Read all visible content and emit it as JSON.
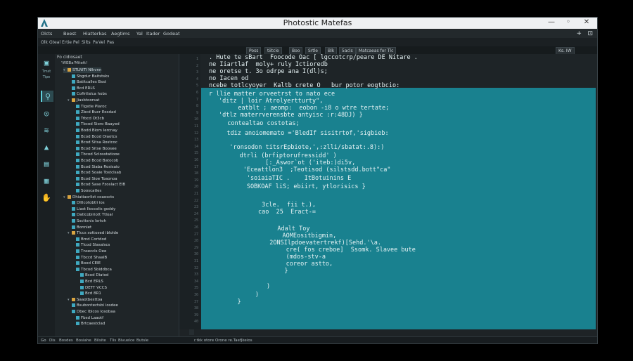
{
  "window": {
    "title": "Photostic Matefas",
    "controls": [
      "—",
      "◦",
      "✕"
    ]
  },
  "menubar": {
    "items": [
      "Olcts",
      "Beest",
      "Hiatterkas",
      "Aegtims",
      "Yal",
      "Itader",
      "Godeat"
    ],
    "right": [
      "+",
      "⊡"
    ]
  },
  "toolbar": {
    "items": [
      "Olk",
      "Gteal",
      "Ertie",
      "Pel",
      "Silts",
      "Pa",
      "Vel",
      "Pas"
    ]
  },
  "tabbar": {
    "tabs": [
      "Poss",
      "tiitcle",
      "Boo",
      "Srtle",
      "Blk",
      "5acls",
      "Matcaeas for Tlc",
      "Ks. IW"
    ]
  },
  "activity": {
    "label1": "Tmst",
    "label2": "Tipe"
  },
  "sidebar": {
    "header": "Fo cidiosaet",
    "subheader": "'WEBa'Mitett!",
    "tree": [
      {
        "label": "STLNITI Nlkvnn",
        "indent": 2,
        "kind": "folder",
        "tw": "▾"
      },
      {
        "label": "Sbgdur Baitstsks",
        "indent": 3,
        "kind": "file",
        "tw": ""
      },
      {
        "label": "Batitcalles Bsst",
        "indent": 3,
        "kind": "file",
        "tw": ""
      },
      {
        "label": "Bcd ERLS",
        "indent": 3,
        "kind": "file",
        "tw": ""
      },
      {
        "label": "Cofirtlalca hobs",
        "indent": 3,
        "kind": "file",
        "tw": ""
      },
      {
        "label": "Jiasbtoorsat",
        "indent": 3,
        "kind": "folder",
        "tw": "▾"
      },
      {
        "label": "Tigstle Plaroc",
        "indent": 4,
        "kind": "file",
        "tw": ""
      },
      {
        "label": "Zbcd Bucr Eosdad",
        "indent": 4,
        "kind": "file",
        "tw": ""
      },
      {
        "label": "Trbcd Ot3cb",
        "indent": 4,
        "kind": "file",
        "tw": ""
      },
      {
        "label": "Tbcod Sioro Baayed",
        "indent": 4,
        "kind": "file",
        "tw": ""
      },
      {
        "label": "Bodd Biom Iercnay",
        "indent": 4,
        "kind": "file",
        "tw": ""
      },
      {
        "label": "Bcod Bcod Oiaotcs",
        "indent": 4,
        "kind": "file",
        "tw": ""
      },
      {
        "label": "Bcod Sitsa Rostcoc",
        "indent": 4,
        "kind": "file",
        "tw": ""
      },
      {
        "label": "Bcod Sitse Boosee",
        "indent": 4,
        "kind": "file",
        "tw": ""
      },
      {
        "label": "Tbcod Sclosstatiooe",
        "indent": 4,
        "kind": "file",
        "tw": ""
      },
      {
        "label": "Bcod Bcod Batocob",
        "indent": 4,
        "kind": "file",
        "tw": ""
      },
      {
        "label": "Bcod Siaba Rosisaio",
        "indent": 4,
        "kind": "file",
        "tw": ""
      },
      {
        "label": "Bcod Soaie Tostclsab",
        "indent": 4,
        "kind": "file",
        "tw": ""
      },
      {
        "label": "Bcod Sioe Toaonoa",
        "indent": 4,
        "kind": "file",
        "tw": ""
      },
      {
        "label": "Bcod Sase Fzoslact ElB",
        "indent": 4,
        "kind": "file",
        "tw": ""
      },
      {
        "label": "Sooscatles",
        "indent": 4,
        "kind": "file",
        "tw": ""
      },
      {
        "label": "Dhiatiaorlist coaoscts",
        "indent": 2,
        "kind": "folder",
        "tw": "▾"
      },
      {
        "label": "Dltlcotobtli ios",
        "indent": 3,
        "kind": "file",
        "tw": ""
      },
      {
        "label": "Liast Iloccolis goddy",
        "indent": 3,
        "kind": "file",
        "tw": ""
      },
      {
        "label": "Datlcobiriott Ttloal",
        "indent": 3,
        "kind": "file",
        "tw": ""
      },
      {
        "label": "Sscttsnis Isrtoh",
        "indent": 3,
        "kind": "file",
        "tw": ""
      },
      {
        "label": "Bonniet",
        "indent": 3,
        "kind": "file",
        "tw": ""
      },
      {
        "label": "Tlccs sottosed iblolde",
        "indent": 3,
        "kind": "folder",
        "tw": "▾"
      },
      {
        "label": "Bmd Cortdod",
        "indent": 4,
        "kind": "file",
        "tw": ""
      },
      {
        "label": "Tlcod Slasalscs",
        "indent": 4,
        "kind": "file",
        "tw": ""
      },
      {
        "label": "Tnseccls Oee",
        "indent": 4,
        "kind": "file",
        "tw": ""
      },
      {
        "label": "Tbccd ShaalB",
        "indent": 4,
        "kind": "file",
        "tw": ""
      },
      {
        "label": "Bood CEIE",
        "indent": 4,
        "kind": "file",
        "tw": ""
      },
      {
        "label": "Tbcod Sbiddbca",
        "indent": 4,
        "kind": "file",
        "tw": ""
      },
      {
        "label": "Bcod Diatod",
        "indent": 5,
        "kind": "file",
        "tw": ""
      },
      {
        "label": "Bcd ERLS",
        "indent": 5,
        "kind": "file",
        "tw": ""
      },
      {
        "label": "DETT VCCS",
        "indent": 5,
        "kind": "file",
        "tw": ""
      },
      {
        "label": "Bcd 8R1",
        "indent": 5,
        "kind": "file",
        "tw": ""
      },
      {
        "label": "Saaotbesttoa",
        "indent": 3,
        "kind": "folder",
        "tw": "▾"
      },
      {
        "label": "Bsubontectsbi iosdee",
        "indent": 3,
        "kind": "file",
        "tw": ""
      },
      {
        "label": "Dbec Iblcos Iosobaa",
        "indent": 3,
        "kind": "file",
        "tw": ""
      },
      {
        "label": "Fbsd Laaotf",
        "indent": 4,
        "kind": "file",
        "tw": ""
      },
      {
        "label": "Brtcaestclad",
        "indent": 4,
        "kind": "file",
        "tw": ""
      }
    ]
  },
  "gutter": {
    "lines": [
      "1",
      "2",
      "3",
      "4",
      "5",
      "6",
      "7",
      "8",
      "9",
      "10",
      "11",
      "12",
      "13",
      "14",
      "15",
      "16",
      "17",
      "18",
      "19",
      "20",
      "21",
      "22",
      "23",
      "24",
      "25",
      "26",
      "27",
      "28",
      "29",
      "30",
      "31",
      "32",
      "33",
      "34",
      "35",
      "36",
      "37",
      "38",
      "39",
      "40"
    ]
  },
  "editor": {
    "lines": [
      {
        "text": ". Hute te sBart  Foocode Oac [ lgccotcrp/peare DE Nitare .",
        "cls": "c-w"
      },
      {
        "text": "ne Iiartlaf  moly+ ruly Ictioredb",
        "cls": "c-w"
      },
      {
        "text": "ne oretse t. 3o odrpe ana I(dl)s;",
        "cls": "c-w"
      },
      {
        "text": "no Iacen od",
        "cls": "c-w"
      },
      {
        "text": "ncebe totlcyoyer  Kaltb crete O   bur potor eogtbcio:",
        "cls": "c-y"
      },
      {
        "text": "r llie matter orveetrst to nato ece",
        "cls": "c-w"
      },
      {
        "text": "'ditz | loir Atrolyertturty\",",
        "cls": "c-w"
      },
      {
        "text": "   eatblt ; aeomp:  eobon -i8 o wtre tertate;",
        "cls": "c-w"
      },
      {
        "text": "'dtlz materrverensbte antyisc :r:48DJ) }",
        "cls": "c-w"
      },
      {
        "text": "  contealtao costotas;",
        "cls": "c-w"
      },
      {
        "text": "   tdiz anoiomemato ='BledIf sisitrtof,'sigbieb:",
        "cls": "c-y"
      },
      {
        "text": "   'ronsodon titsrEpbiote,',:zlli/sbatat:.8):)",
        "cls": "c-y"
      },
      {
        "text": "     dtrli (brfiptorufressidd' )",
        "cls": "c-y"
      },
      {
        "text": "           [:_Aswor`ot ('iteb:)di5v,",
        "cls": "c-w"
      },
      {
        "text": "      'Eceattlon3  ;Teotisod (silstsdd.bott\"ca\"",
        "cls": "c-r"
      },
      {
        "text": "       'soiaiaTIC .    ItBotuinins E",
        "cls": "c-r"
      },
      {
        "text": "       SOBKOAF liS; ebiirt, ytlorisics }",
        "cls": "c-w"
      },
      {
        "text": "          3cle.  fii t.),",
        "cls": "c-w"
      },
      {
        "text": "         cao  25  Eract-=",
        "cls": "c-w"
      },
      {
        "text": "            Adalt Toy",
        "cls": "c-r"
      },
      {
        "text": "             AOMEositbigmin,",
        "cls": "c-w"
      },
      {
        "text": "           2ONSIlpdoevatertrekf)[Sehd.'\\a.",
        "cls": "c-w"
      },
      {
        "text": "              cre( fos creboe]  Ssomk. Slavee bute",
        "cls": "c-w"
      },
      {
        "text": "              (mdos-stv-a",
        "cls": "c-w"
      },
      {
        "text": "              coreor astto,",
        "cls": "c-w"
      },
      {
        "text": "            }",
        "cls": "c-w"
      },
      {
        "text": "         )",
        "cls": "c-w"
      },
      {
        "text": "       )",
        "cls": "c-w"
      },
      {
        "text": "    }",
        "cls": "c-w"
      }
    ]
  },
  "statusbar": {
    "items": [
      "Go",
      "Dis",
      "Bosdes",
      "Bosiahe",
      "Bilsite",
      "Tlis",
      "Bivuelce",
      "Butsle"
    ],
    "path": "r.tkk otore Orone re.TaefJkeios"
  }
}
